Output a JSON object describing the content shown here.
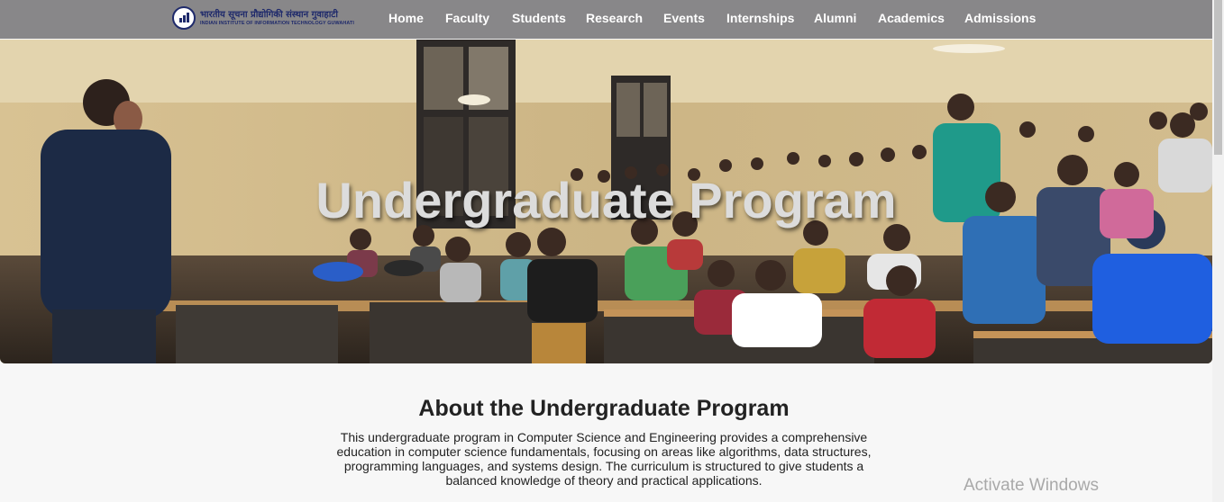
{
  "header": {
    "logo_hindi": "भारतीय सूचना प्रौद्योगिकी संस्थान गुवाहाटी",
    "logo_english": "INDIAN INSTITUTE OF INFORMATION TECHNOLOGY GUWAHATI",
    "nav": [
      "Home",
      "Faculty",
      "Students",
      "Research",
      "Events",
      "Internships",
      "Alumni",
      "Academics",
      "Admissions"
    ]
  },
  "hero": {
    "title": "Undergraduate Program"
  },
  "about": {
    "title": "About the Undergraduate Program",
    "text": "This undergraduate program in Computer Science and Engineering provides a comprehensive education in computer science fundamentals, focusing on areas like algorithms, data structures, programming languages, and systems design. The curriculum is structured to give students a balanced knowledge of theory and practical applications."
  },
  "watermark": {
    "title": "Activate Windows"
  }
}
